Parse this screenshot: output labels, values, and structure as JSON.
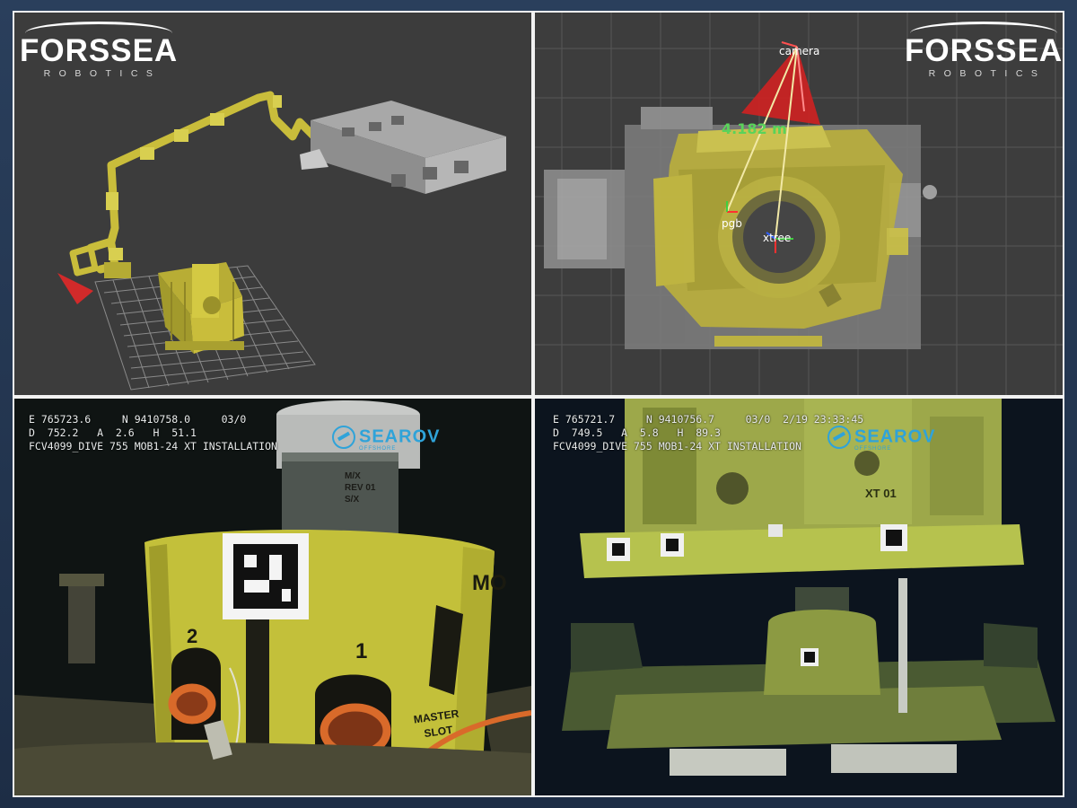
{
  "brand": {
    "name": "FORSSEA",
    "tagline": "ROBOTICS"
  },
  "rviz_top_right": {
    "labels": {
      "camera": "camera",
      "distance": "4.182 m",
      "pgb": "pgb",
      "xtree": "xtree"
    }
  },
  "feed_left": {
    "hud_line1": "E 765723.6     N 9410758.0     03/0",
    "hud_line2": "D  752.2   A  2.6   H  51.1",
    "hud_line3": "FCV4099_DIVE 755 MOB1-24 XT INSTALLATION",
    "overlay_logo": "SEAROV",
    "overlay_logo_sub": "OFFSHORE",
    "marking_2": "2",
    "marking_1": "1",
    "marking_mo": "MO",
    "master_slot": "MASTER\nSLOT",
    "plate_text": "M/X\nREV 01\nS/X"
  },
  "feed_right": {
    "hud_line1": "E 765721.7     N 9410756.7     03/0  2/19 23:33:45",
    "hud_line2": "D  749.5   A  5.8   H  89.3",
    "hud_line3": "FCV4099_DIVE 755 MOB1-24 XT INSTALLATION",
    "overlay_logo": "SEAROV",
    "overlay_logo_sub": "OFFSHORE",
    "tag_text": "XT 01"
  },
  "colors": {
    "model_yellow": "#c9bd3b",
    "frame_bg": "#f2f2f2",
    "hud_text": "#e9ecec",
    "searov_blue": "#2fa3d9",
    "distance_green": "#5ad35a",
    "cone_red": "#d22a2a"
  }
}
